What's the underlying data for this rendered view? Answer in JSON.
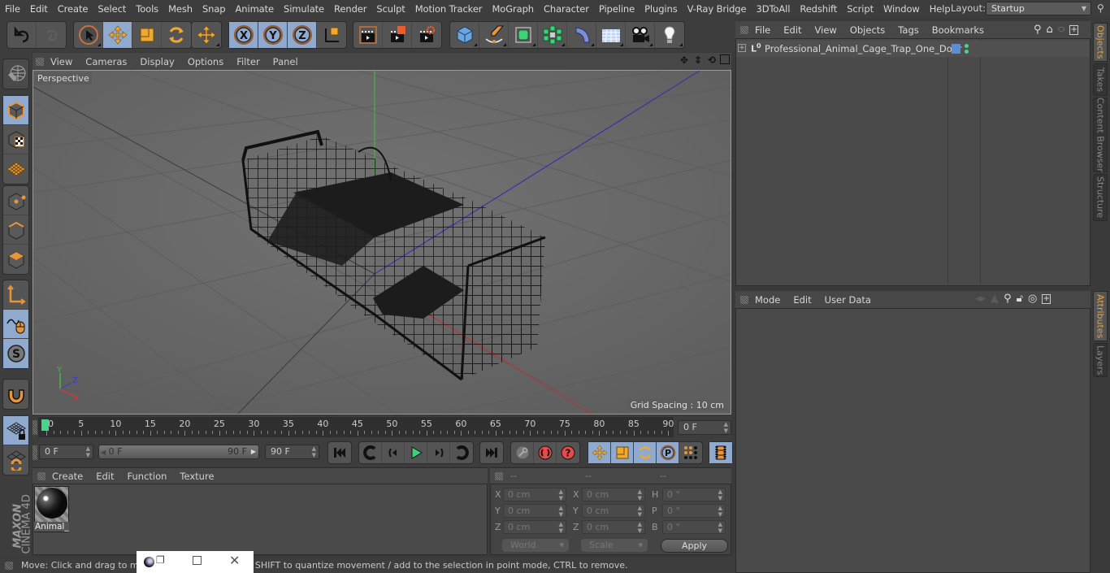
{
  "menubar": {
    "items": [
      "File",
      "Edit",
      "Create",
      "Select",
      "Tools",
      "Mesh",
      "Snap",
      "Animate",
      "Simulate",
      "Render",
      "Sculpt",
      "Motion Tracker",
      "MoGraph",
      "Character",
      "Pipeline",
      "Plugins",
      "V-Ray Bridge",
      "3DToAll",
      "Redshift",
      "Script",
      "Window",
      "Help"
    ],
    "layout_label": "Layout:",
    "layout_value": "Startup"
  },
  "toolbar": {
    "groups": [
      [
        "undo-icon",
        "redo-icon"
      ],
      [
        "live-selection-icon",
        "move-icon",
        "scale-icon",
        "rotate-icon"
      ],
      [
        "last-tool-icon"
      ],
      [
        "x-axis-icon",
        "y-axis-icon",
        "z-axis-icon",
        "coordinate-system-icon"
      ],
      [
        "render-view-icon",
        "render-picture-viewer-icon",
        "render-settings-icon"
      ],
      [
        "cube-icon",
        "pen-icon",
        "subdivision-icon",
        "cloner-icon",
        "bend-deformer-icon",
        "floor-icon",
        "camera-icon",
        "light-icon"
      ]
    ]
  },
  "left_toolbar": {
    "items": [
      "make-editable-icon",
      "model-mode-icon",
      "texture-mode-icon",
      "workplane-mode-icon",
      "points-mode-icon",
      "edges-mode-icon",
      "polygons-mode-icon",
      "axis-mode-icon",
      "tweak-mode-icon",
      "solo-icon",
      "snapping-icon",
      "lock-workplane-icon",
      "workplane-icon"
    ],
    "brand": "MAXON",
    "product": "CINEMA 4D"
  },
  "viewport": {
    "menu": [
      "View",
      "Cameras",
      "Display",
      "Options",
      "Filter",
      "Panel"
    ],
    "camera_label": "Perspective",
    "grid_spacing": "Grid Spacing : 10 cm",
    "axis_labels": {
      "x": "X",
      "y": "Y",
      "z": "Z"
    }
  },
  "timeline": {
    "ticks": [
      "0",
      "5",
      "10",
      "15",
      "20",
      "25",
      "30",
      "35",
      "40",
      "45",
      "50",
      "55",
      "60",
      "65",
      "70",
      "75",
      "80",
      "85",
      "90"
    ],
    "current_frame": "0 F",
    "start_field": "0 F",
    "range_start": "0 F",
    "range_end": "90 F",
    "end_field": "90 F",
    "playhead_color": "#46d68a"
  },
  "material_manager": {
    "menu": [
      "Create",
      "Edit",
      "Function",
      "Texture"
    ],
    "materials": [
      {
        "name": "Animal_"
      }
    ]
  },
  "coordinates": {
    "headers": [
      "--",
      "--",
      "--"
    ],
    "rows": [
      {
        "l1": "X",
        "v1": "0 cm",
        "l2": "X",
        "v2": "0 cm",
        "l3": "H",
        "v3": "0 °"
      },
      {
        "l1": "Y",
        "v1": "0 cm",
        "l2": "Y",
        "v2": "0 cm",
        "l3": "P",
        "v3": "0 °"
      },
      {
        "l1": "Z",
        "v1": "0 cm",
        "l2": "Z",
        "v2": "0 cm",
        "l3": "B",
        "v3": "0 °"
      }
    ],
    "space_dropdown": "World",
    "mode_dropdown": "Scale",
    "apply_label": "Apply"
  },
  "status_bar": {
    "text": "Move: Click and drag to move elements. Hold down SHIFT to quantize movement / add to the selection in point mode, CTRL to remove."
  },
  "object_manager": {
    "menu": [
      "File",
      "Edit",
      "View",
      "Objects",
      "Tags",
      "Bookmarks"
    ],
    "objects": [
      {
        "name": "Professional_Animal_Cage_Trap_One_Door",
        "layer_color": "#5b8fd4"
      }
    ]
  },
  "attribute_manager": {
    "menu": [
      "Mode",
      "Edit",
      "User Data"
    ]
  },
  "right_tabs": {
    "top": [
      {
        "label": "Objects",
        "active": true
      },
      {
        "label": "Takes",
        "active": false
      },
      {
        "label": "Content Browser",
        "active": false
      },
      {
        "label": "Structure",
        "active": false
      }
    ],
    "bottom": [
      {
        "label": "Attributes",
        "active": true
      },
      {
        "label": "Layers",
        "active": false
      }
    ]
  },
  "colors": {
    "accent_orange": "#e8a33d",
    "selected_blue": "#8fa9cf"
  }
}
